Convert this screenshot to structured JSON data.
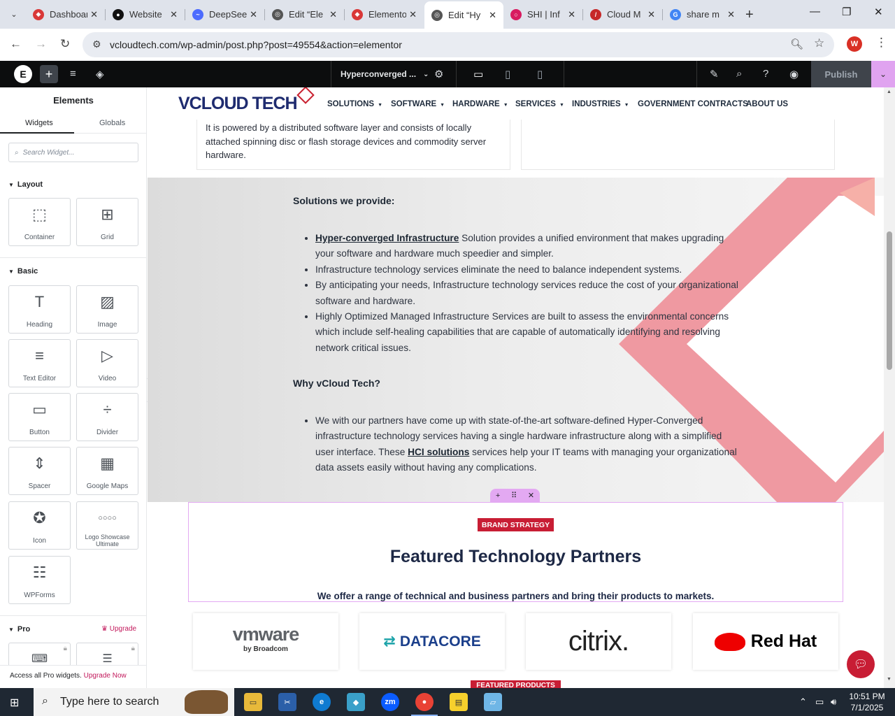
{
  "browser": {
    "tabs": [
      {
        "label": "Dashboard",
        "favicon": "elementor-icon",
        "color": "#d93838"
      },
      {
        "label": "Website",
        "favicon": "github-icon",
        "color": "#111111"
      },
      {
        "label": "DeepSeek",
        "favicon": "deepseek-icon",
        "color": "#4d6bfe"
      },
      {
        "label": "Edit “Ele",
        "favicon": "globe-icon",
        "color": "#555555"
      },
      {
        "label": "Elementor",
        "favicon": "elementor-icon",
        "color": "#d93838"
      },
      {
        "label": "Edit “Hy",
        "favicon": "globe-icon",
        "color": "#555555",
        "active": true
      },
      {
        "label": "SHI | Inf",
        "favicon": "shi-icon",
        "color": "#d81b60"
      },
      {
        "label": "Cloud M",
        "favicon": "cloud-icon",
        "color": "#c62828"
      },
      {
        "label": "share m",
        "favicon": "google-icon",
        "color": "#4285f4"
      }
    ],
    "url": "vcloudtech.com/wp-admin/post.php?post=49554&action=elementor",
    "profile_initial": "W"
  },
  "elementor": {
    "document_title": "Hyperconverged ...",
    "publish_label": "Publish"
  },
  "panel": {
    "title": "Elements",
    "tabs": [
      "Widgets",
      "Globals"
    ],
    "search_placeholder": "Search Widget...",
    "sections": {
      "layout": "Layout",
      "basic": "Basic",
      "pro": "Pro"
    },
    "layout_widgets": [
      {
        "label": "Container",
        "icon": "container-icon"
      },
      {
        "label": "Grid",
        "icon": "grid-icon"
      }
    ],
    "basic_widgets": [
      {
        "label": "Heading",
        "icon": "heading-icon"
      },
      {
        "label": "Image",
        "icon": "image-icon"
      },
      {
        "label": "Text Editor",
        "icon": "text-editor-icon"
      },
      {
        "label": "Video",
        "icon": "video-icon"
      },
      {
        "label": "Button",
        "icon": "button-icon"
      },
      {
        "label": "Divider",
        "icon": "divider-icon"
      },
      {
        "label": "Spacer",
        "icon": "spacer-icon"
      },
      {
        "label": "Google Maps",
        "icon": "google-maps-icon"
      },
      {
        "label": "Icon",
        "icon": "star-icon"
      },
      {
        "label": "Logo Showcase Ultimate",
        "icon": "logo-showcase-icon"
      },
      {
        "label": "WPForms",
        "icon": "wpforms-icon"
      }
    ],
    "upgrade_label": "Upgrade",
    "footer_text": "Access all Pro widgets.",
    "footer_link": "Upgrade Now"
  },
  "site": {
    "logo_text": "VCLOUD TECH",
    "menu": [
      {
        "label": "SOLUTIONS",
        "dropdown": true
      },
      {
        "label": "SOFTWARE",
        "dropdown": true
      },
      {
        "label": "HARDWARE",
        "dropdown": true
      },
      {
        "label": "SERVICES",
        "dropdown": true
      },
      {
        "label": "INDUSTRIES",
        "dropdown": true
      },
      {
        "label": "GOVERNMENT CONTRACTS",
        "dropdown": false
      },
      {
        "label": "ABOUT US",
        "dropdown": false
      }
    ],
    "card_text": "It is powered by a distributed software layer and consists of locally attached spinning disc or flash storage devices and commodity server hardware.",
    "solutions_heading": "Solutions we provide:",
    "solutions": {
      "item1_link": "Hyper-converged Infrastructure",
      "item1_rest": " Solution provides a unified environment that makes upgrading your software and hardware much speedier and simpler.",
      "item2": "Infrastructure technology services eliminate the need to balance independent systems.",
      "item3": "By anticipating your needs, Infrastructure technology services reduce the cost of your organizational software and hardware.",
      "item4": "Highly Optimized Managed Infrastructure Services are built to assess the environmental concerns which include self-healing capabilities that are capable of automatically identifying and resolving network critical issues."
    },
    "why_heading": "Why vCloud Tech?",
    "why": {
      "before": "We with our partners have come up with state-of-the-art software-defined Hyper-Converged infrastructure technology services having a single hardware infrastructure along with a simplified user interface. These ",
      "link": "HCI solutions",
      "after": " services help your IT teams with managing your organizational data assets easily without having any complications."
    },
    "badge": "BRAND STRATEGY",
    "featured_title": "Featured Technology Partners",
    "featured_sub": "We offer a range of technical and business partners and bring their products to markets.",
    "partners": {
      "vmware": "vmware",
      "vmware_sub": "by Broadcom",
      "datacore": "DATACORE",
      "citrix": "citrix.",
      "redhat": "Red Hat"
    },
    "featured_products": "FEATURED PRODUCTS"
  },
  "taskbar": {
    "search_placeholder": "Type here to search",
    "time": "10:51 PM",
    "date": "7/1/2025"
  },
  "colors": {
    "brand_red": "#c81d34",
    "elementor_pink": "#e3a9f2",
    "chevron_pink": "#f08a97"
  }
}
